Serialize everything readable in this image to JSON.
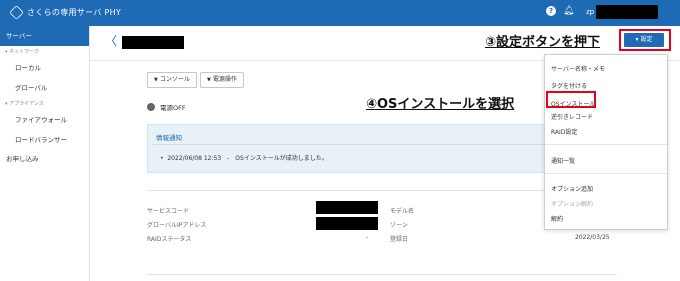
{
  "app": {
    "title": "さくらの専用サーバ PHY"
  },
  "header": {
    "help_icon": "?",
    "user_prefix": "zp"
  },
  "sidebar": {
    "items": [
      {
        "label": "サーバー",
        "active": true
      },
      {
        "group": "ネットワーク"
      },
      {
        "label": "ローカル"
      },
      {
        "label": "グローバル"
      },
      {
        "group": "アプライアンス"
      },
      {
        "label": "ファイアウォール"
      },
      {
        "label": "ロードバランサー"
      },
      {
        "label": "お申し込み"
      }
    ]
  },
  "main": {
    "back_label": "〈",
    "console_button": "コンソール",
    "power_button": "電源操作",
    "power_status": "電源OFF",
    "notice": {
      "title": "情報通知",
      "item": "2022/06/08 12:53　-　OSインストールが成功しました。"
    },
    "info": {
      "service_code_label": "サービスコード",
      "global_ip_label": "グローバルIPアドレス",
      "raid_status_label": "RAIDステータス",
      "raid_status_value": "-",
      "model_label": "モデル名",
      "zone_label": "ゾーン",
      "registered_label": "登録日",
      "registered_value": "2022/03/25"
    }
  },
  "settings_button": "設定",
  "dropdown": {
    "items": [
      {
        "label": "サーバー名称・メモ"
      },
      {
        "label": "タグを付ける"
      },
      {
        "label": "OSインストール",
        "highlighted": true
      },
      {
        "label": "逆引きレコード"
      },
      {
        "label": "RAID設定"
      },
      {
        "label": "通知一覧"
      },
      {
        "label": "オプション追加"
      },
      {
        "label": "オプション解約",
        "disabled": true
      },
      {
        "label": "解約"
      }
    ]
  },
  "annotations": {
    "step3": "③設定ボタンを押下",
    "step4": "④OSインストールを選択"
  },
  "colors": {
    "accent": "#1e6ab4",
    "highlight": "#e6001e"
  }
}
